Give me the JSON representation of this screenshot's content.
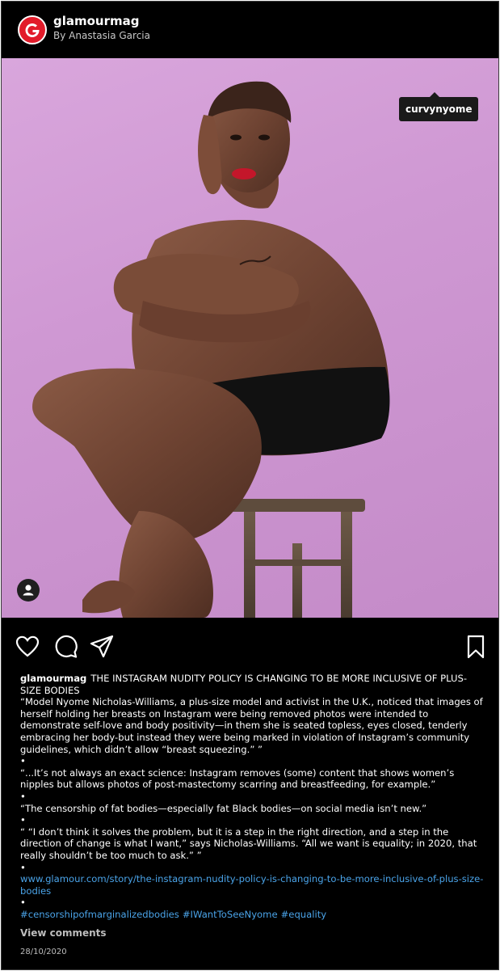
{
  "account": {
    "username": "glamourmag",
    "byline": "By Anastasia Garcia",
    "logo_letter": "G",
    "logo_color": "#e21b2a"
  },
  "photo": {
    "tag_label": "curvynyome",
    "background_color": "#d09ad4"
  },
  "icons": {
    "like": "heart-icon",
    "comment": "comment-icon",
    "share": "paper-plane-icon",
    "save": "bookmark-icon",
    "tagged_users": "user-icon"
  },
  "caption": {
    "username": "glamourmag",
    "headline": "THE INSTAGRAM NUDITY POLICY IS CHANGING TO BE MORE INCLUSIVE OF PLUS-SIZE BODIES",
    "paragraphs": [
      "“Model Nyome Nicholas-Williams, a plus-size model and activist in the U.K., noticed that images of herself holding her breasts on Instagram were being removed photos were intended to demonstrate self-love and body positivity—in them she is seated topless, eyes closed, tenderly embracing her body-but instead they were being marked in violation of Instagram’s community guidelines, which didn’t allow “breast squeezing.” ”",
      "•",
      "“...It’s not always an exact science: Instagram removes (some) content that shows women’s nipples but allows photos of post-mastectomy scarring and breastfeeding, for example.”",
      "•",
      "“The censorship of fat bodies—especially fat Black bodies—on social media isn’t new.”",
      "•",
      "“ “I don’t think it solves the problem, but it is a step in the right direction, and a step in the direction of change is what I want,” says Nicholas-Williams. “All we want is equality; in 2020, that really shouldn’t be too much to ask.” ”",
      "•"
    ],
    "link": "www.glamour.com/story/the-instagram-nudity-policy-is-changing-to-be-more-inclusive-of-plus-size-bodies",
    "separator_after_link": "•",
    "hashtags": [
      "#censorshipofmarginalizedbodies",
      "#IWantToSeeNyome",
      "#equality"
    ],
    "link_color": "#4aa3e8"
  },
  "footer": {
    "view_comments": "View  comments",
    "date": "28/10/2020"
  }
}
